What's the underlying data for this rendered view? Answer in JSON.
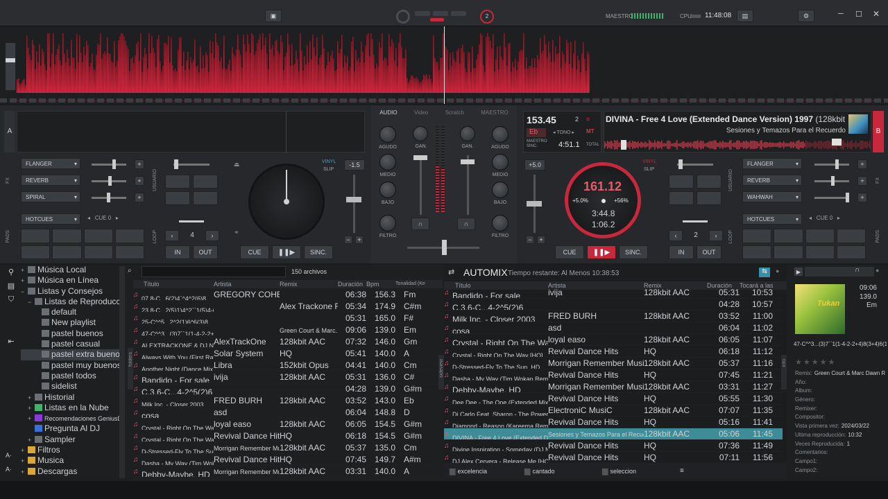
{
  "topbar": {
    "master_label": "MAESTRO",
    "cpu_label": "CPU",
    "clock": "11:48:08",
    "rec_count": "2"
  },
  "deck_a": {
    "letter": "A",
    "fx": [
      "FLANGER",
      "REVERB",
      "SPIRAL"
    ],
    "hotcues_label": "HOTCUES",
    "cue_label": "CUE 0",
    "loop_value": "4",
    "vinyl": "VINYL",
    "slip": "SLIP",
    "pitch": "-1.5",
    "in_label": "IN",
    "out_label": "OUT",
    "cue_btn": "CUE",
    "sync_btn": "SINC.",
    "fx_side": "FX",
    "pads_side": "PADS",
    "user_side": "USUARIO",
    "loop_side": "LOOP"
  },
  "deck_b": {
    "letter": "B",
    "bpm": "153.45",
    "key": "Eb",
    "deck_num": "2",
    "tono_label": "TONO",
    "mt_label": "MT",
    "master_sync_label": "MAESTRO\nSINC.",
    "total_time": "4:51.1",
    "total_label": "TOTAL",
    "title": "DIVINA - Free 4 Love (Extended Dance Version) 1997",
    "title_extra": "(128kbit",
    "subtitle": "Sesiones y Temazos Para el Recuerdo",
    "jog_bpm": "161.12",
    "jog_pitch_left": "+5.0%",
    "jog_pitch_right": "+56%",
    "elapsed": "3:44.8",
    "remaining": "1:06.2",
    "pitch": "+5.0",
    "vinyl": "VINYL",
    "slip": "SLIP",
    "fx": [
      "FLANGER",
      "REVERB",
      "WAHWAH"
    ],
    "hotcues_label": "HOTCUES",
    "cue_label": "CUE 0",
    "loop_value": "2",
    "in_label": "IN",
    "out_label": "OUT",
    "cue_btn": "CUE",
    "sync_btn": "SINC."
  },
  "mixer": {
    "tabs": [
      "AUDIO",
      "Video",
      "Scratch",
      "MAESTRO"
    ],
    "agudo": "AGUDO",
    "medio": "MEDIO",
    "bajo": "BAJO",
    "filtro": "FILTRO",
    "gan": "GAN."
  },
  "sidebar": {
    "items": [
      {
        "label": "Música Local",
        "level": 0,
        "exp": "+"
      },
      {
        "label": "Música en Línea",
        "level": 0,
        "exp": "+"
      },
      {
        "label": "Listas y Consejos",
        "level": 0,
        "exp": "−"
      },
      {
        "label": "Listas de Reproducción",
        "level": 1,
        "exp": "−"
      },
      {
        "label": "default",
        "level": 2,
        "exp": ""
      },
      {
        "label": "New playlist",
        "level": 2,
        "exp": ""
      },
      {
        "label": "pastel buenos",
        "level": 2,
        "exp": ""
      },
      {
        "label": "pastel casual",
        "level": 2,
        "exp": ""
      },
      {
        "label": "pastel extra buenos",
        "level": 2,
        "exp": "",
        "selected": true
      },
      {
        "label": "pastel muy buenos",
        "level": 2,
        "exp": ""
      },
      {
        "label": "pastel todos",
        "level": 2,
        "exp": ""
      },
      {
        "label": "sidelist",
        "level": 2,
        "exp": ""
      },
      {
        "label": "Historial",
        "level": 1,
        "exp": "+"
      },
      {
        "label": "Listas en la Nube",
        "level": 1,
        "exp": "+"
      },
      {
        "label": "Recomendaciones GeniusDJ",
        "level": 1,
        "exp": "+"
      },
      {
        "label": "Pregunta Al DJ",
        "level": 1,
        "exp": ""
      },
      {
        "label": "Sampler",
        "level": 1,
        "exp": "+"
      },
      {
        "label": "Filtros",
        "level": 0,
        "exp": "+"
      },
      {
        "label": "Musica",
        "level": 0,
        "exp": "+"
      },
      {
        "label": "Descargas",
        "level": 0,
        "exp": "+"
      }
    ]
  },
  "filelist": {
    "count": "150 archivos",
    "headers": [
      "Título",
      "Artista",
      "Remix",
      "Duración",
      "Bpm",
      "Tonalidad (Ke"
    ],
    "side_label": "folders",
    "rows": [
      [
        "07.8-C...6(2)4`^4^2(6)8",
        "GREGORY COHEN & CRI",
        "",
        "06:38",
        "156.3",
        "Fm"
      ],
      [
        "23.8-C...2(5)1)4^2``1(5)4-6",
        "",
        "Alex Trackone Remix",
        "05:34",
        "174.9",
        "C#m"
      ],
      [
        "25-C^^5...2^2(1)6^6(3)8",
        "",
        "",
        "05:31",
        "165.0",
        "F#"
      ],
      [
        "47-C^^3...(3)7``1(1-4-2-2+4)...",
        "",
        "Green Court & Marc...",
        "09:06",
        "139.0",
        "Em"
      ],
      [
        "ALEXTRACKONE & DJ NAP...",
        "AlexTrackOne",
        "128kbit AAC",
        "07:32",
        "146.0",
        "Gm"
      ],
      [
        "Always With You (First Ray...",
        "Solar System",
        "HQ",
        "05:41",
        "140.0",
        "A"
      ],
      [
        "Another Night (Dance Mix) 1...",
        "Libra",
        "152kbit Opus",
        "04:41",
        "140.0",
        "Cm"
      ],
      [
        "Bandido - For sale",
        "ivija",
        "128kbit AAC",
        "05:31",
        "136.0",
        "C#"
      ],
      [
        "C.3.6-C...4-2^5(2)6",
        "",
        "",
        "04:28",
        "139.0",
        "G#m"
      ],
      [
        "Milk Inc. - Closer 2003",
        "FRED BURH",
        "128kbit AAC",
        "03:52",
        "143.0",
        "Eb"
      ],
      [
        "cosa",
        "asd",
        "",
        "06:04",
        "148.8",
        "D"
      ],
      [
        "Crystal - Right On The Way",
        "loyal easo",
        "128kbit AAC",
        "06:05",
        "154.5",
        "G#m"
      ],
      [
        "Crystal - Right On The Way [...",
        "Revival Dance Hits",
        "HQ",
        "06:18",
        "154.5",
        "G#m"
      ],
      [
        "D-Stressed-Fly To The Sun...",
        "Morrigan Remember Mu...",
        "128kbit AAC",
        "05:37",
        "135.0",
        "Cm"
      ],
      [
        "Dasha - My Way (Tim Woka...",
        "Revival Dance Hits",
        "HQ",
        "07:45",
        "149.7",
        "A#m"
      ],
      [
        "Debby-Maybe. HD",
        "Morrigan Remember Mu...",
        "128kbit AAC",
        "03:31",
        "140.0",
        "A"
      ]
    ]
  },
  "automix": {
    "title": "AUTOMIX",
    "remaining": "Tiempo restante: Al Menos 10:38:53",
    "headers": [
      "Título",
      "Artista",
      "Remix",
      "Duración",
      "Tocará a las"
    ],
    "side_label": "sideview",
    "rows": [
      [
        "Bandido - For sale",
        "ivija",
        "128kbit AAC",
        "05:31",
        "10:53"
      ],
      [
        "C.3.6-C...4-2^5(2)6",
        "",
        "",
        "04:28",
        "10:57"
      ],
      [
        "Milk Inc. - Closer 2003",
        "FRED BURH",
        "128kbit AAC",
        "03:52",
        "11:00"
      ],
      [
        "cosa",
        "asd",
        "",
        "06:04",
        "11:02"
      ],
      [
        "Crystal - Right On The Way",
        "loyal easo",
        "128kbit AAC",
        "06:05",
        "11:07"
      ],
      [
        "Crystal - Right On The Way [HQ]",
        "Revival Dance Hits",
        "HQ",
        "06:18",
        "11:12"
      ],
      [
        "D-Stressed-Fly To The Sun. HD",
        "Morrigan Remember Music",
        "128kbit AAC",
        "05:37",
        "11:16"
      ],
      [
        "Dasha - My Way (Tim Wokan Remix...",
        "Revival Dance Hits",
        "HQ",
        "07:45",
        "11:21"
      ],
      [
        "Debby-Maybe. HD",
        "Morrigan Remember Music",
        "128kbit AAC",
        "03:31",
        "11:27"
      ],
      [
        "Dee Dee - The One (Extended Mix) [...",
        "Revival Dance Hits",
        "HQ",
        "05:55",
        "11:30"
      ],
      [
        "Di Carlo Feat. Sharon - The Power...",
        "ElectroniC MusiC",
        "128kbit AAC",
        "07:07",
        "11:35"
      ],
      [
        "Diamond - Reason (Kareema Remix...",
        "Revival Dance Hits",
        "HQ",
        "05:16",
        "11:41"
      ],
      [
        "DIVINA - Free 4 Love (Extended Da...",
        "Sesiones y Temazos Para el Recuerdo",
        "128kbit AAC",
        "05:06",
        "11:45"
      ],
      [
        "Divine Inspiration - Someday (DJ Na...",
        "Revival Dance Hits",
        "HQ",
        "07:36",
        "11:49"
      ],
      [
        "DJ Alex Cervera - Release Me [HQ]",
        "Revival Dance Hits",
        "HQ",
        "07:11",
        "11:56"
      ]
    ],
    "folders": [
      "excelencia",
      "cantado",
      "seleccion"
    ]
  },
  "info": {
    "side_label": "info",
    "time": "09:06",
    "bpm": "139.0",
    "key": "Em",
    "title": "47-C^^3...(3)7``1(1-4-2-2+4)8(3+4)6(1)",
    "cover_text": "Tukan",
    "fields": [
      {
        "label": "Remix:",
        "value": "Green Court & Marc Dawn Remi"
      },
      {
        "label": "Año:",
        "value": ""
      },
      {
        "label": "Album:",
        "value": ""
      },
      {
        "label": "Género:",
        "value": ""
      },
      {
        "label": "Remixer:",
        "value": ""
      },
      {
        "label": "Compositor:",
        "value": ""
      },
      {
        "label": "Vista primera vez:",
        "value": "2024/03/22"
      },
      {
        "label": "Ultima reproducción:",
        "value": "10:32"
      },
      {
        "label": "Veces Reproducida:",
        "value": "1"
      },
      {
        "label": "Comentarios:",
        "value": ""
      },
      {
        "label": "Campo1:",
        "value": ""
      },
      {
        "label": "Campo2:",
        "value": ""
      }
    ]
  }
}
